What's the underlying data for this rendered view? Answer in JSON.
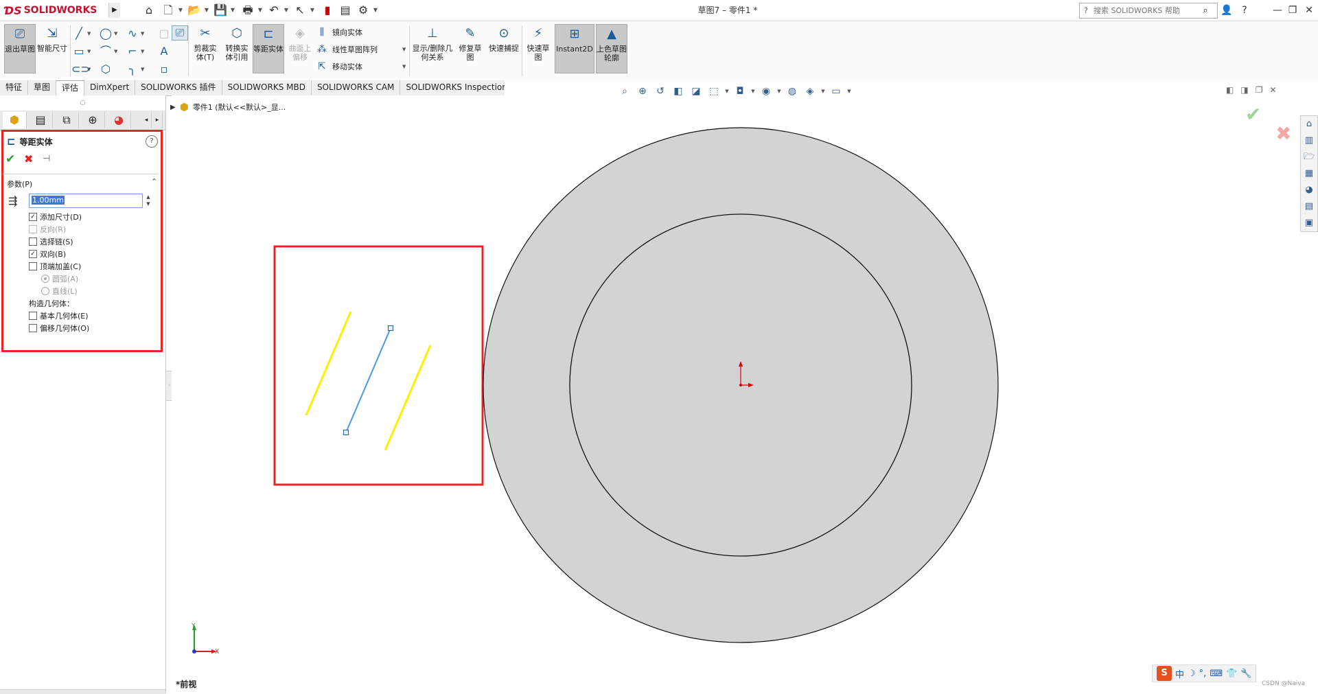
{
  "app": {
    "logo_text": "SOLIDWORKS",
    "document_title": "草图7 – 零件1 *",
    "search_placeholder": "搜索 SOLIDWORKS 帮助"
  },
  "ribbon": {
    "exit_sketch": "退出草图",
    "smart_dim": "智能尺寸",
    "trim": "剪裁实体(T)",
    "convert": "转换实体引用",
    "offset": "等距实体",
    "surface_offset": "曲面上偏移",
    "mirror": "镜向实体",
    "linear_pattern": "线性草图阵列",
    "move": "移动实体",
    "show_relations": "显示/删除几何关系",
    "repair": "修复草图",
    "quick_snap": "快速捕捉",
    "rapid_sketch": "快速草图",
    "instant2d": "Instant2D",
    "shaded_contours": "上色草图轮廓"
  },
  "tabs": [
    {
      "label": "特征"
    },
    {
      "label": "草图"
    },
    {
      "label": "评估"
    },
    {
      "label": "DimXpert"
    },
    {
      "label": "SOLIDWORKS 插件"
    },
    {
      "label": "SOLIDWORKS MBD"
    },
    {
      "label": "SOLIDWORKS CAM"
    },
    {
      "label": "SOLIDWORKS Inspection"
    }
  ],
  "property_manager": {
    "title": "等距实体",
    "group_label": "参数(P)",
    "distance_value": "1.00mm",
    "options": [
      {
        "label": "添加尺寸(D)",
        "checked": true,
        "disabled": false
      },
      {
        "label": "反向(R)",
        "checked": false,
        "disabled": true
      },
      {
        "label": "选择链(S)",
        "checked": false,
        "disabled": false
      },
      {
        "label": "双向(B)",
        "checked": true,
        "disabled": false
      },
      {
        "label": "顶端加盖(C)",
        "checked": false,
        "disabled": false
      }
    ],
    "cap_options": [
      {
        "label": "圆弧(A)",
        "selected": true
      },
      {
        "label": "直线(L)",
        "selected": false
      }
    ],
    "construction_label": "构造几何体：",
    "construction_options": [
      {
        "label": "基本几何体(E)",
        "checked": false
      },
      {
        "label": "偏移几何体(O)",
        "checked": false
      }
    ]
  },
  "graphics": {
    "tree_path": "零件1 (默认<<默认>_显...",
    "view_label": "*前视",
    "triad": {
      "x": "X",
      "y": "Y"
    }
  },
  "ime": {
    "logo": "S",
    "mode": "中"
  },
  "watermark": "CSDN @Naiva",
  "colors": {
    "highlight_frame": "#e8262a",
    "offset_preview": "#ffef00",
    "selected_line": "#4a98e0",
    "part_fill": "#d3d3d3",
    "origin": "#d80000"
  }
}
